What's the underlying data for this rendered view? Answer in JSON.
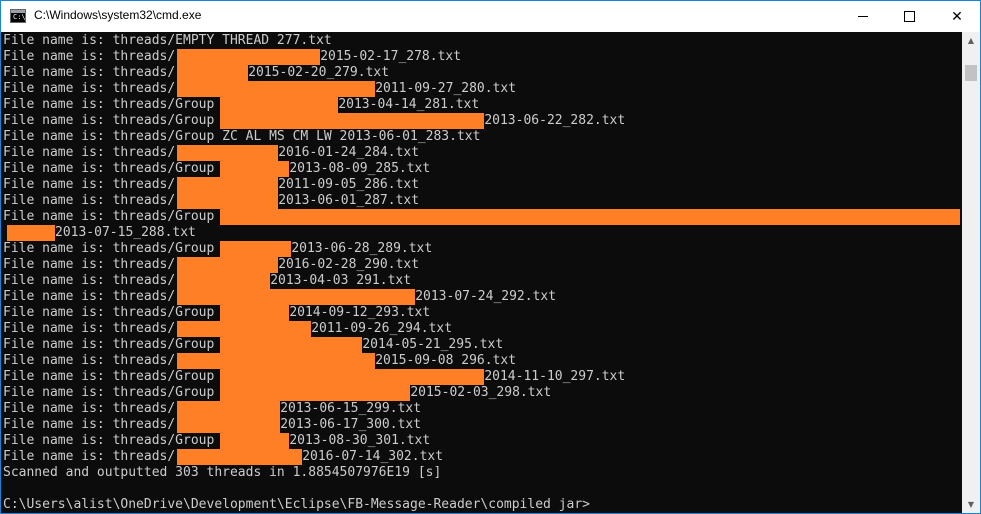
{
  "window": {
    "title": "C:\\Windows\\system32\\cmd.exe",
    "icon": "cmd-icon"
  },
  "controls": {
    "minimize": "minimize-icon",
    "maximize": "maximize-icon",
    "close": "close-icon",
    "close_glyph": "✕"
  },
  "console": {
    "lines": [
      {
        "pre": "File name is: threads/EMPTY THREAD 277.txt",
        "post": ""
      },
      {
        "pre": "File name is: threads/",
        "post": "2015-02-17_278.txt"
      },
      {
        "pre": "File name is: threads/",
        "post": "2015-02-20_279.txt"
      },
      {
        "pre": "File name is: threads/",
        "post": "2011-09-27_280.txt"
      },
      {
        "pre": "File name is: threads/Group",
        "post": "2013-04-14_281.txt"
      },
      {
        "pre": "File name is: threads/Group",
        "post": "2013-06-22_282.txt"
      },
      {
        "pre": "File name is: threads/Group ZC AL MS CM LW 2013-06-01_283.txt",
        "post": ""
      },
      {
        "pre": "File name is: threads/",
        "post": "2016-01-24_284.txt"
      },
      {
        "pre": "File name is: threads/Group",
        "post": "2013-08-09_285.txt"
      },
      {
        "pre": "File name is: threads/",
        "post": "2011-09-05_286.txt"
      },
      {
        "pre": "File name is: threads/",
        "post": "2013-06-01_287.txt"
      },
      {
        "pre": "File name is: threads/Group",
        "post": ""
      },
      {
        "pre": "",
        "post": "2013-07-15_288.txt"
      },
      {
        "pre": "File name is: threads/Group",
        "post": "2013-06-28_289.txt"
      },
      {
        "pre": "File name is: threads/",
        "post": "2016-02-28_290.txt"
      },
      {
        "pre": "File name is: threads/",
        "post": "2013-04-03 291.txt"
      },
      {
        "pre": "File name is: threads/",
        "post": "2013-07-24_292.txt"
      },
      {
        "pre": "File name is: threads/Group",
        "post": "2014-09-12_293.txt"
      },
      {
        "pre": "File name is: threads/",
        "post": "2011-09-26_294.txt"
      },
      {
        "pre": "File name is: threads/Group",
        "post": "2014-05-21_295.txt"
      },
      {
        "pre": "File name is: threads/",
        "post": "2015-09-08 296.txt"
      },
      {
        "pre": "File name is: threads/Group",
        "post": "2014-11-10_297.txt"
      },
      {
        "pre": "File name is: threads/Group",
        "post": "2015-02-03_298.txt"
      },
      {
        "pre": "File name is: threads/",
        "post": "2013-06-15_299.txt"
      },
      {
        "pre": "File name is: threads/",
        "post": "2013-06-17_300.txt"
      },
      {
        "pre": "File name is: threads/Group",
        "post": "2013-08-30_301.txt"
      },
      {
        "pre": "File name is: threads/",
        "post": "2016-07-14_302.txt"
      },
      {
        "pre": "Scanned and outputted 303 threads in 1.8854507976E19 [s]",
        "post": ""
      },
      {
        "pre": "",
        "post": ""
      },
      {
        "pre": "C:\\Users\\alist\\OneDrive\\Development\\Eclipse\\FB-Message-Reader\\compiled jar>",
        "post": ""
      }
    ]
  },
  "colors": {
    "background": "#0c0c0c",
    "text": "#cccccc",
    "redaction": "#ff7f27",
    "border": "#1883d7"
  },
  "scrollbar": {
    "up": "scroll-up-arrow",
    "down": "scroll-down-arrow",
    "up_glyph": "▲",
    "down_glyph": "▼"
  }
}
